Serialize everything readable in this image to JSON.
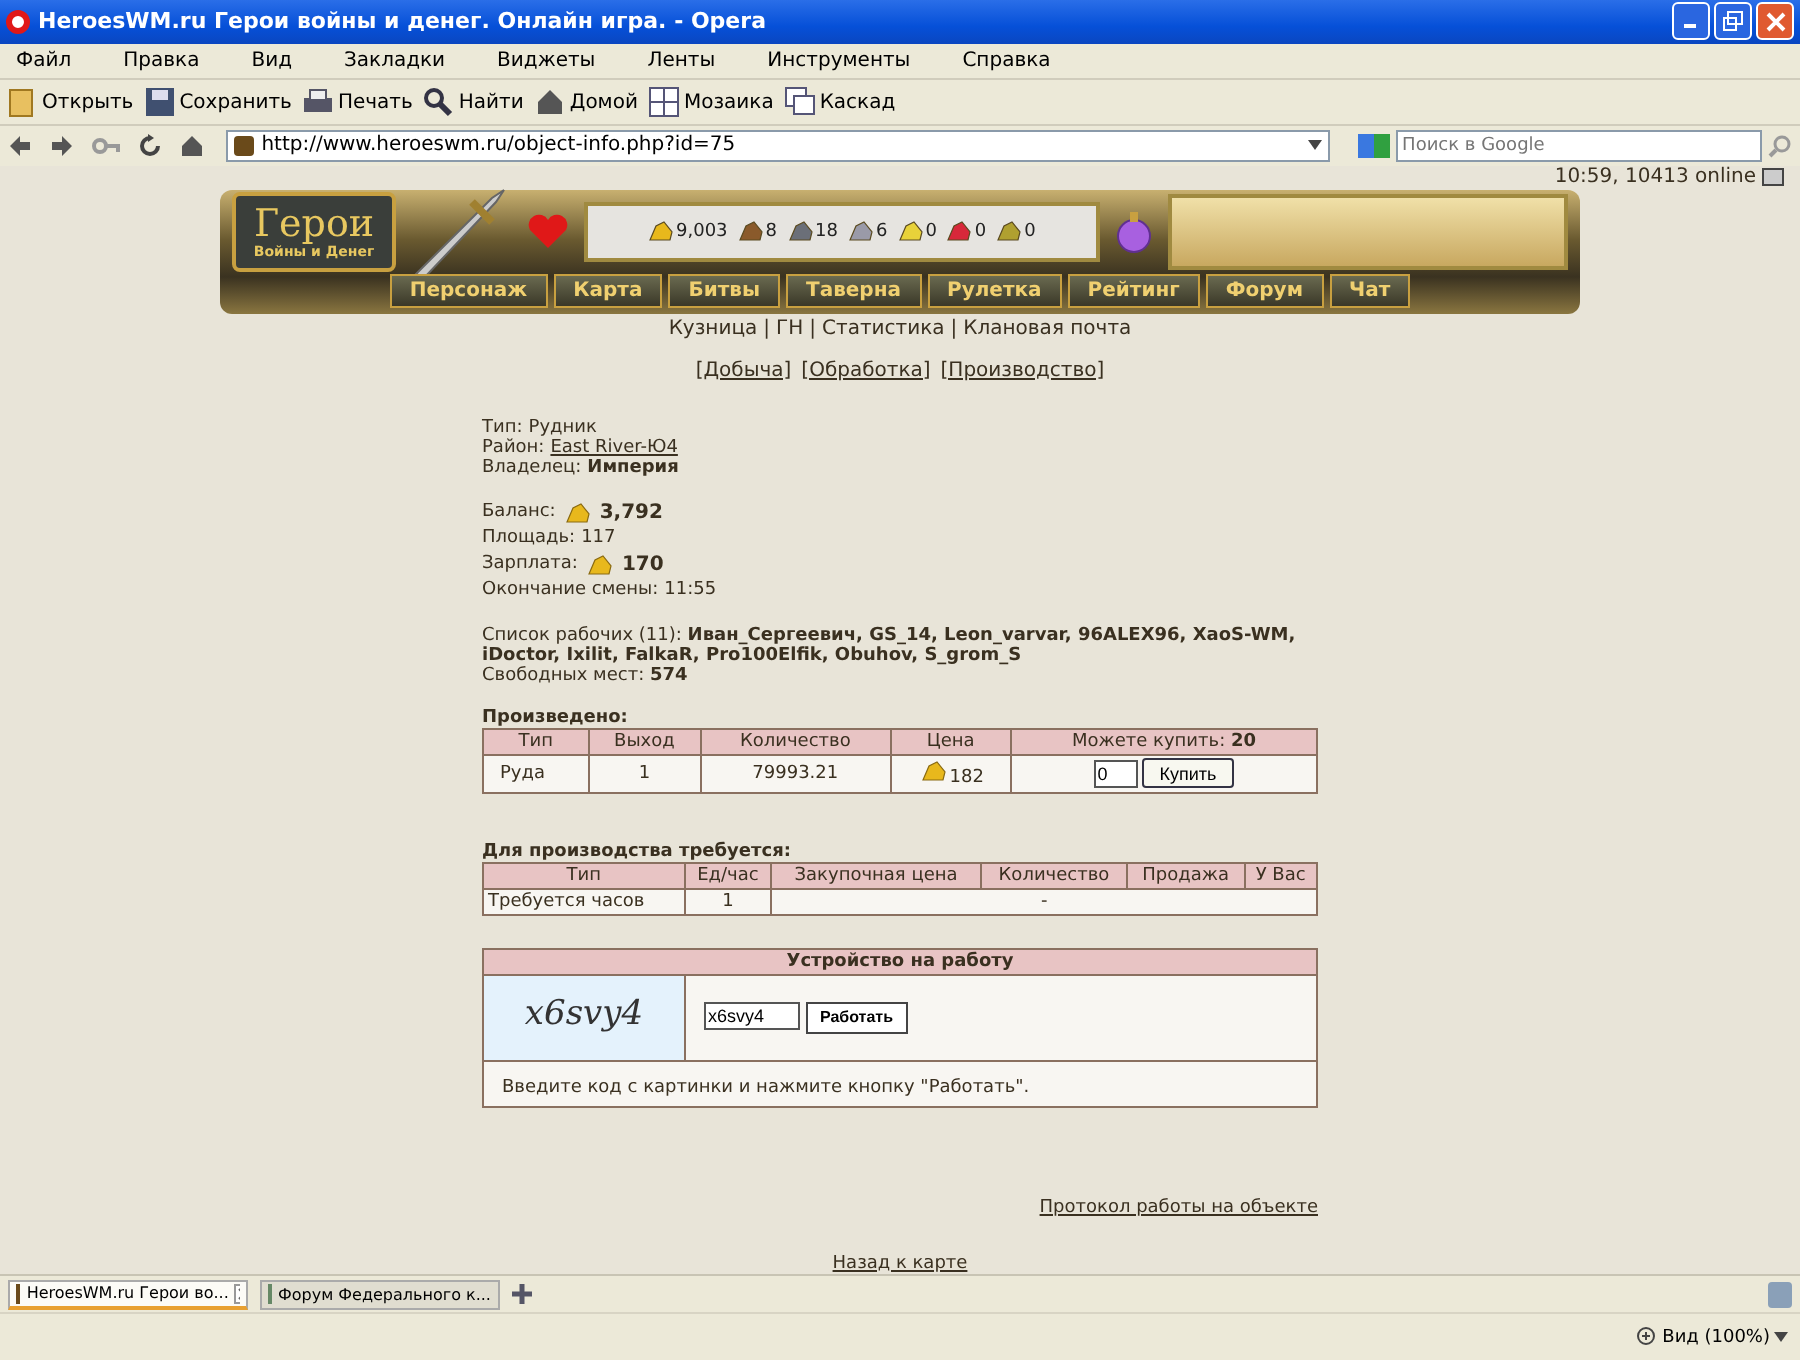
{
  "window": {
    "title": "HeroesWM.ru Герои войны и денег. Онлайн игра. - Opera"
  },
  "menu": [
    "Файл",
    "Правка",
    "Вид",
    "Закладки",
    "Виджеты",
    "Ленты",
    "Инструменты",
    "Справка"
  ],
  "toolbar": [
    {
      "kind": "open",
      "label": "Открыть"
    },
    {
      "kind": "save",
      "label": "Сохранить"
    },
    {
      "kind": "print",
      "label": "Печать"
    },
    {
      "kind": "find",
      "label": "Найти"
    },
    {
      "kind": "home",
      "label": "Домой"
    },
    {
      "kind": "tile",
      "label": "Мозаика"
    },
    {
      "kind": "cascade",
      "label": "Каскад"
    }
  ],
  "address": {
    "url": "http://www.heroeswm.ru/object-info.php?id=75",
    "search_placeholder": "Поиск в Google"
  },
  "header": {
    "logo_title": "Герои",
    "logo_subtitle": "Войны и Денег",
    "online": "10:59, 10413 online",
    "resources": [
      {
        "kind": "gold",
        "value": "9,003"
      },
      {
        "kind": "wood",
        "value": "8"
      },
      {
        "kind": "ore",
        "value": "18"
      },
      {
        "kind": "mercury",
        "value": "6"
      },
      {
        "kind": "sulfur",
        "value": "0"
      },
      {
        "kind": "crystal",
        "value": "0"
      },
      {
        "kind": "gems",
        "value": "0"
      }
    ],
    "nav": [
      "Персонаж",
      "Карта",
      "Битвы",
      "Таверна",
      "Рулетка",
      "Рейтинг",
      "Форум",
      "Чат"
    ],
    "sublinks": [
      "Кузница",
      "ГН",
      "Статистика",
      "Клановая почта"
    ],
    "separator": "|"
  },
  "tabs": [
    "[Добыча]",
    "[Обработка]",
    "[Производство]"
  ],
  "info": [
    {
      "label": "Тип:",
      "value": "Рудник",
      "kind": "plain"
    },
    {
      "label": "Район:",
      "value": "East River-Ю4",
      "kind": "link"
    },
    {
      "label": "Владелец:",
      "value": "Империя",
      "kind": "bold"
    }
  ],
  "stats": [
    {
      "label": "Баланс:",
      "value": "3,792",
      "kind": "gold"
    },
    {
      "label": "Площадь:",
      "value": "117",
      "kind": "plain"
    },
    {
      "label": "Зарплата:",
      "value": "170",
      "kind": "gold"
    },
    {
      "label": "Окончание смены:",
      "value": "11:55",
      "kind": "plain"
    }
  ],
  "workers": "Список рабочих (11): **Иван_Сергеевич, GS_14, Leon_varvar, 96ALEX96, XaoS-WM, iDoctor, Ixilit, FalkaR, Pro100Elfik, Obuhov, S_grom_S**",
  "free_places": "Свободных мест: **574**",
  "produced": {
    "title": "Произведено:",
    "columns": [
      "Тип",
      "Выход",
      "Количество",
      "Цена",
      "Можете купить: **20**"
    ],
    "row": {
      "type": "Руда",
      "output": "1",
      "quantity": "79993.21",
      "price": "182",
      "amount": "0",
      "buy_button": "Купить"
    }
  },
  "required": {
    "title": "Для производства требуется:",
    "columns": [
      "Тип",
      "Ед/час",
      "Закупочная цена",
      "Количество",
      "Продажа",
      "У Вас"
    ],
    "row": {
      "type": "Требуется часов",
      "per_hour": "1",
      "rest": "-"
    }
  },
  "job": {
    "title": "Устройство на работу",
    "captcha": "x6svy4",
    "code": "x6svy4",
    "button": "Работать",
    "hint": "Введите код с картинки и нажмите кнопку \"Работать\"."
  },
  "log_link": "Протокол работы на объекте",
  "back_link": "Назад к карте",
  "browser_tabs": [
    {
      "title": "HeroesWM.ru Герои во...",
      "selected": true
    },
    {
      "title": "Форум Федерального к...",
      "selected": false
    }
  ],
  "status": {
    "zoom": "Вид (100%)"
  }
}
